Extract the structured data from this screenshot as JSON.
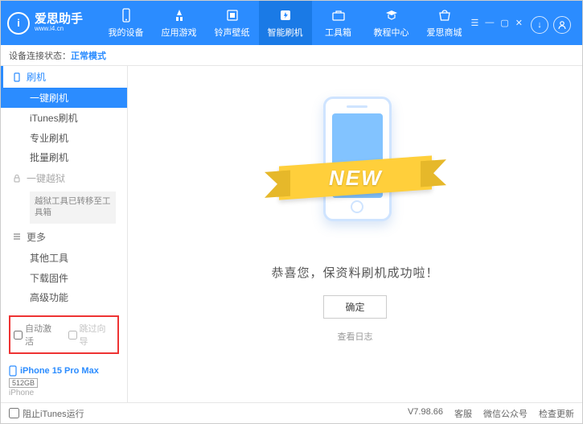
{
  "header": {
    "app_name": "爱思助手",
    "app_url": "www.i4.cn",
    "logo_letter": "i",
    "nav": [
      {
        "label": "我的设备"
      },
      {
        "label": "应用游戏"
      },
      {
        "label": "铃声壁纸"
      },
      {
        "label": "智能刷机"
      },
      {
        "label": "工具箱"
      },
      {
        "label": "教程中心"
      },
      {
        "label": "爱思商城"
      }
    ]
  },
  "status": {
    "prefix": "设备连接状态：",
    "mode": "正常模式"
  },
  "sidebar": {
    "flash_section": "刷机",
    "flash_items": [
      "一键刷机",
      "iTunes刷机",
      "专业刷机",
      "批量刷机"
    ],
    "jailbreak_section": "一键越狱",
    "jailbreak_note": "越狱工具已转移至工具箱",
    "more_section": "更多",
    "more_items": [
      "其他工具",
      "下载固件",
      "高级功能"
    ],
    "auto_activate": "自动激活",
    "skip_setup": "跳过向导",
    "device": {
      "name": "iPhone 15 Pro Max",
      "storage": "512GB",
      "type": "iPhone"
    }
  },
  "main": {
    "ribbon": "NEW",
    "success": "恭喜您，保资料刷机成功啦！",
    "confirm": "确定",
    "view_log": "查看日志"
  },
  "footer": {
    "block_itunes": "阻止iTunes运行",
    "version": "V7.98.66",
    "links": [
      "客服",
      "微信公众号",
      "检查更新"
    ]
  }
}
